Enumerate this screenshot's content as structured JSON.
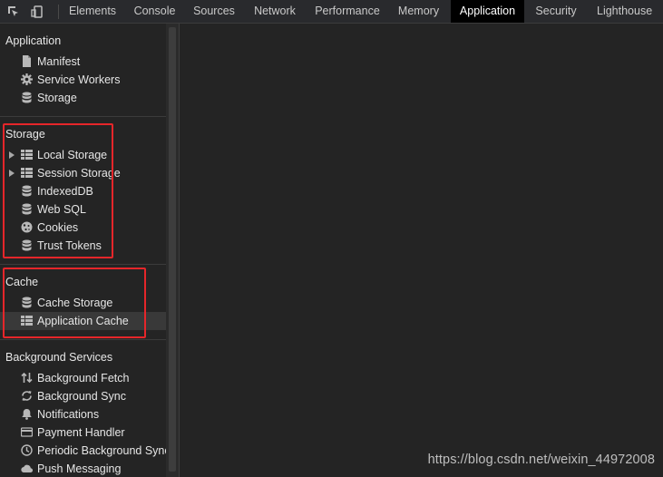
{
  "tabs": [
    {
      "label": "Elements",
      "active": false
    },
    {
      "label": "Console",
      "active": false
    },
    {
      "label": "Sources",
      "active": false
    },
    {
      "label": "Network",
      "active": false
    },
    {
      "label": "Performance",
      "active": false
    },
    {
      "label": "Memory",
      "active": false
    },
    {
      "label": "Application",
      "active": true
    },
    {
      "label": "Security",
      "active": false
    },
    {
      "label": "Lighthouse",
      "active": false
    }
  ],
  "sidebar": {
    "application": {
      "title": "Application",
      "items": [
        {
          "label": "Manifest",
          "icon": "document-icon"
        },
        {
          "label": "Service Workers",
          "icon": "gear-icon"
        },
        {
          "label": "Storage",
          "icon": "database-icon"
        }
      ]
    },
    "storage": {
      "title": "Storage",
      "items": [
        {
          "label": "Local Storage",
          "icon": "table-icon",
          "expandable": true
        },
        {
          "label": "Session Storage",
          "icon": "table-icon",
          "expandable": true
        },
        {
          "label": "IndexedDB",
          "icon": "database-icon"
        },
        {
          "label": "Web SQL",
          "icon": "database-icon"
        },
        {
          "label": "Cookies",
          "icon": "cookie-icon"
        },
        {
          "label": "Trust Tokens",
          "icon": "database-icon"
        }
      ]
    },
    "cache": {
      "title": "Cache",
      "items": [
        {
          "label": "Cache Storage",
          "icon": "database-icon"
        },
        {
          "label": "Application Cache",
          "icon": "table-icon",
          "selected": true
        }
      ]
    },
    "background": {
      "title": "Background Services",
      "items": [
        {
          "label": "Background Fetch",
          "icon": "up-down-arrows-icon"
        },
        {
          "label": "Background Sync",
          "icon": "sync-icon"
        },
        {
          "label": "Notifications",
          "icon": "bell-icon"
        },
        {
          "label": "Payment Handler",
          "icon": "card-icon"
        },
        {
          "label": "Periodic Background Sync",
          "icon": "clock-icon"
        },
        {
          "label": "Push Messaging",
          "icon": "cloud-icon"
        }
      ]
    }
  },
  "watermark": "https://blog.csdn.net/weixin_44972008",
  "colors": {
    "highlight": "#e5262a",
    "active_tab_bg": "#000000",
    "background": "#242424"
  }
}
